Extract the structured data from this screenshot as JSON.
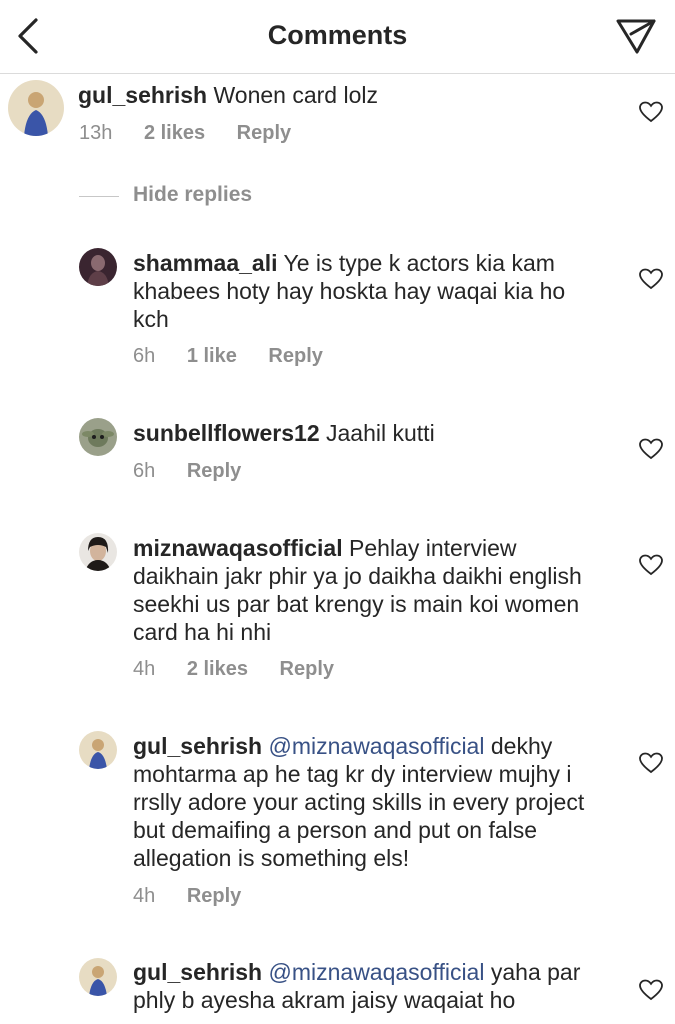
{
  "header": {
    "title": "Comments"
  },
  "top_comment": {
    "username": "gul_sehrish",
    "text": "Wonen card lolz",
    "time": "13h",
    "likes": "2 likes",
    "reply": "Reply"
  },
  "hide_replies": "Hide replies",
  "replies": [
    {
      "username": "shammaa_ali",
      "mention": "",
      "text": "Ye is type k actors kia kam khabees hoty hay hoskta hay waqai kia ho kch",
      "time": "6h",
      "likes": "1 like",
      "reply": "Reply"
    },
    {
      "username": "sunbellflowers12",
      "mention": "",
      "text": "Jaahil kutti",
      "time": "6h",
      "likes": "",
      "reply": "Reply"
    },
    {
      "username": "miznawaqasofficial",
      "mention": "",
      "text": "Pehlay interview daikhain jakr phir ya jo daikha daikhi english seekhi us par bat krengy is main koi women card ha hi nhi",
      "time": "4h",
      "likes": "2 likes",
      "reply": "Reply"
    },
    {
      "username": "gul_sehrish",
      "mention": "@miznawaqasofficial",
      "text": "dekhy mohtarma ap he tag kr dy interview mujhy i rrslly adore your acting skills in every project but demaifing a person and put on false allegation is something els!",
      "time": "4h",
      "likes": "",
      "reply": "Reply"
    },
    {
      "username": "gul_sehrish",
      "mention": "@miznawaqasofficial",
      "text": "yaha par phly b ayesha akram jaisy waqaiat ho",
      "time": "",
      "likes": "",
      "reply": ""
    }
  ],
  "colors": {
    "text": "#262626",
    "muted": "#8e8e8e",
    "mention": "#385185",
    "divider": "#dbdbdb"
  }
}
